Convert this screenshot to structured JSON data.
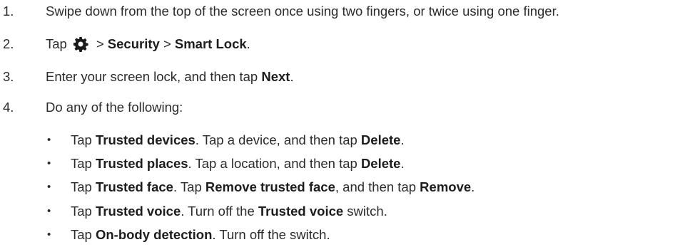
{
  "steps": [
    {
      "number": "1.",
      "text": "Swipe down from the top of the screen once using two fingers, or twice using one finger."
    },
    {
      "number": "2.",
      "prefix": "Tap",
      "icon": "settings-gear-icon",
      "sep1": ">",
      "b1": "Security",
      "sep2": ">",
      "b2": "Smart Lock",
      "end": "."
    },
    {
      "number": "3.",
      "t1": "Enter your screen lock, and then tap ",
      "b1": "Next",
      "end": "."
    },
    {
      "number": "4.",
      "text": "Do any of the following:"
    }
  ],
  "bullets": [
    {
      "t1": "Tap ",
      "b1": "Trusted devices",
      "t2": ". Tap a device, and then tap ",
      "b2": "Delete",
      "end": "."
    },
    {
      "t1": "Tap ",
      "b1": "Trusted places",
      "t2": ". Tap a location, and then tap ",
      "b2": "Delete",
      "end": "."
    },
    {
      "t1": "Tap ",
      "b1": "Trusted face",
      "t2": ". Tap ",
      "b2": "Remove trusted face",
      "t3": ", and then tap ",
      "b3": "Remove",
      "end": "."
    },
    {
      "t1": "Tap ",
      "b1": "Trusted voice",
      "t2": ". Turn off the ",
      "b2": "Trusted voice",
      "t3": " switch."
    },
    {
      "t1": "Tap ",
      "b1": "On-body detection",
      "t2": ". Turn off the switch."
    }
  ],
  "bullet_glyph": "•"
}
